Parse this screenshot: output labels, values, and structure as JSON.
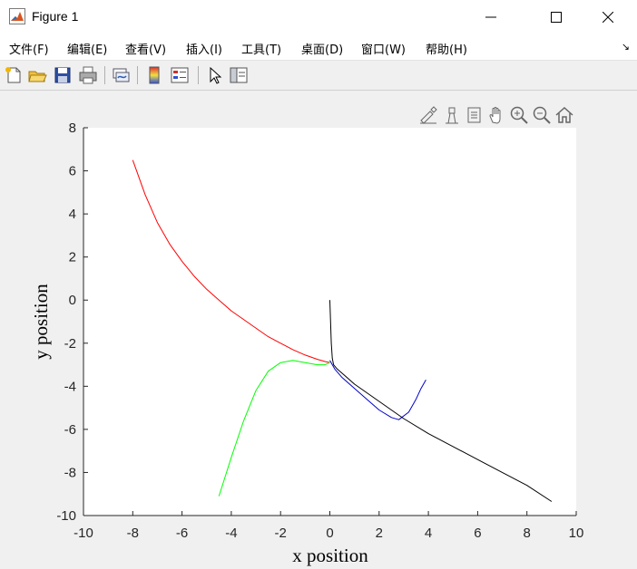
{
  "window": {
    "title": "Figure 1",
    "minimize_glyph": "—",
    "maximize_glyph": "☐",
    "close_glyph": "✕"
  },
  "menu": {
    "items": [
      {
        "label": "文件(F)",
        "name": "menu-file"
      },
      {
        "label": "编辑(E)",
        "name": "menu-edit"
      },
      {
        "label": "查看(V)",
        "name": "menu-view"
      },
      {
        "label": "插入(I)",
        "name": "menu-insert"
      },
      {
        "label": "工具(T)",
        "name": "menu-tools"
      },
      {
        "label": "桌面(D)",
        "name": "menu-desktop"
      },
      {
        "label": "窗口(W)",
        "name": "menu-window"
      },
      {
        "label": "帮助(H)",
        "name": "menu-help"
      }
    ],
    "dock_arrow": "↘"
  },
  "toolbar": {
    "icons": [
      "new-figure-icon",
      "open-file-icon",
      "save-icon",
      "print-icon",
      "link-plot-icon",
      "colorbar-icon",
      "legend-icon",
      "pointer-icon",
      "property-inspector-icon"
    ]
  },
  "axes_toolbar": {
    "icons": [
      "brush-icon",
      "data-tips-icon",
      "rotate-icon",
      "pan-icon",
      "zoom-in-icon",
      "zoom-out-icon",
      "home-icon"
    ]
  },
  "chart_data": {
    "type": "line",
    "title": "",
    "xlabel": "x position",
    "ylabel": "y position",
    "xlim": [
      -10,
      10
    ],
    "ylim": [
      -10,
      8
    ],
    "xticks": [
      -10,
      -8,
      -6,
      -4,
      -2,
      0,
      2,
      4,
      6,
      8,
      10
    ],
    "yticks": [
      -10,
      -8,
      -6,
      -4,
      -2,
      0,
      2,
      4,
      6,
      8
    ],
    "grid": false,
    "series": [
      {
        "color": "#ff0000",
        "x": [
          -8.0,
          -7.5,
          -7.0,
          -6.5,
          -6.0,
          -5.5,
          -5.0,
          -4.5,
          -4.0,
          -3.5,
          -3.0,
          -2.5,
          -2.0,
          -1.5,
          -1.0,
          -0.5,
          -0.2,
          0.0
        ],
        "y": [
          6.5,
          4.9,
          3.6,
          2.6,
          1.8,
          1.1,
          0.5,
          0.0,
          -0.5,
          -0.9,
          -1.3,
          -1.7,
          -2.0,
          -2.3,
          -2.55,
          -2.75,
          -2.85,
          -2.9
        ]
      },
      {
        "color": "#00ff00",
        "x": [
          -4.5,
          -4.0,
          -3.5,
          -3.0,
          -2.5,
          -2.0,
          -1.5,
          -1.0,
          -0.5,
          -0.2,
          0.0
        ],
        "y": [
          -9.1,
          -7.3,
          -5.6,
          -4.2,
          -3.3,
          -2.9,
          -2.8,
          -2.9,
          -3.0,
          -3.0,
          -2.9
        ]
      },
      {
        "color": "#0000cc",
        "x": [
          0.0,
          0.2,
          0.5,
          1.0,
          1.5,
          2.0,
          2.5,
          2.8,
          3.2,
          3.5,
          3.7,
          3.9
        ],
        "y": [
          -2.8,
          -3.2,
          -3.6,
          -4.1,
          -4.6,
          -5.1,
          -5.45,
          -5.55,
          -5.2,
          -4.6,
          -4.1,
          -3.7
        ]
      },
      {
        "color": "#000000",
        "x": [
          0.0,
          0.03,
          0.06,
          0.1,
          0.15,
          0.3,
          0.6,
          1.0,
          2.0,
          3.0,
          4.0,
          5.0,
          6.0,
          7.0,
          8.0,
          9.0
        ],
        "y": [
          0.0,
          -1.0,
          -2.0,
          -2.7,
          -3.0,
          -3.2,
          -3.5,
          -3.9,
          -4.7,
          -5.5,
          -6.2,
          -6.8,
          -7.4,
          -8.0,
          -8.6,
          -9.35
        ]
      }
    ]
  }
}
